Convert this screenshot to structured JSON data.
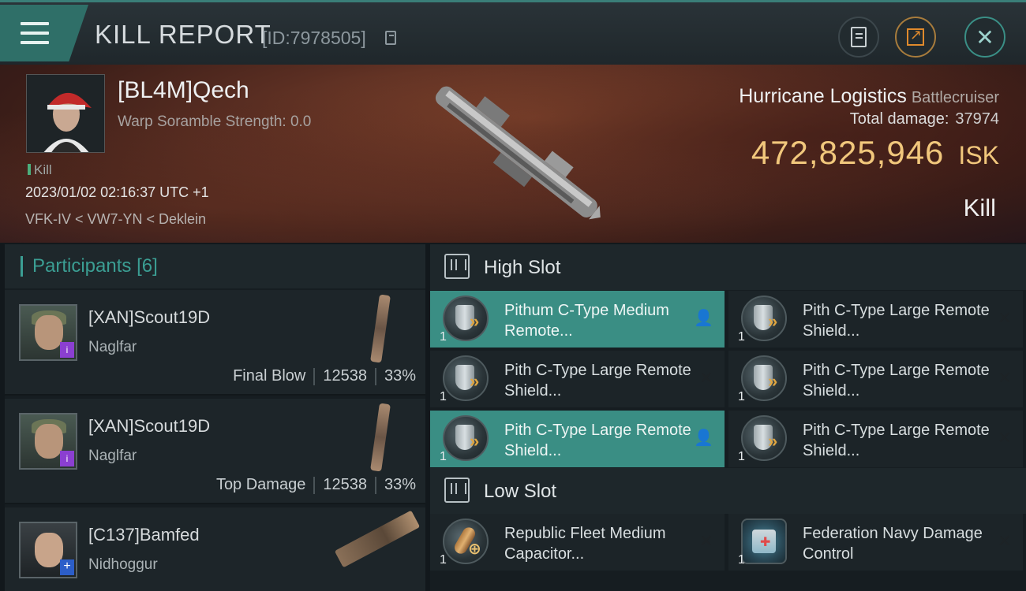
{
  "header": {
    "title": "KILL REPORT",
    "report_id": "[ID:7978505]",
    "menu_icon": "hamburger-icon",
    "actions": [
      {
        "name": "clipboard",
        "icon": "clipboard-icon"
      },
      {
        "name": "share",
        "icon": "share-icon"
      },
      {
        "name": "close",
        "icon": "close-icon",
        "glyph": "✕"
      }
    ]
  },
  "victim": {
    "name": "[BL4M]Qech",
    "subtitle": "Warp Soramble Strength: 0.0",
    "tag": "Kill",
    "time": "2023/01/02 02:16:37 UTC +1",
    "location": "VFK-IV < VW7-YN < Deklein",
    "ship_name": "Hurricane Logistics",
    "ship_class": "Battlecruiser",
    "total_damage_label": "Total damage:",
    "total_damage": "37974",
    "isk_value": "472,825,946",
    "isk_unit": "ISK",
    "result": "Kill"
  },
  "participants": {
    "label": "Participants",
    "count": "[6]",
    "rows": [
      {
        "name": "[XAN]Scout19D",
        "ship": "Naglfar",
        "role": "Final Blow",
        "damage": "12538",
        "pct": "33%",
        "badge": "i"
      },
      {
        "name": "[XAN]Scout19D",
        "ship": "Naglfar",
        "role": "Top Damage",
        "damage": "12538",
        "pct": "33%",
        "badge": "i"
      },
      {
        "name": "[C137]Bamfed",
        "ship": "Nidhoggur",
        "role": "",
        "damage": "",
        "pct": "",
        "badge": "+"
      }
    ]
  },
  "high_slot": {
    "label": "High Slot",
    "modules": [
      {
        "name": "Pithum C-Type Medium Remote...",
        "qty": "1",
        "status": "fitted",
        "icon": "shield-booster-icon"
      },
      {
        "name": "Pith C-Type Large Remote Shield...",
        "qty": "1",
        "status": "destroyed",
        "icon": "shield-booster-icon"
      },
      {
        "name": "Pith C-Type Large Remote Shield...",
        "qty": "1",
        "status": "destroyed",
        "icon": "shield-booster-icon"
      },
      {
        "name": "Pith C-Type Large Remote Shield...",
        "qty": "1",
        "status": "destroyed",
        "icon": "shield-booster-icon"
      },
      {
        "name": "Pith C-Type Large Remote Shield...",
        "qty": "1",
        "status": "fitted",
        "icon": "shield-booster-icon"
      },
      {
        "name": "Pith C-Type Large Remote Shield...",
        "qty": "1",
        "status": "destroyed",
        "icon": "shield-booster-icon"
      }
    ]
  },
  "low_slot": {
    "label": "Low Slot",
    "modules": [
      {
        "name": "Republic Fleet Medium Capacitor...",
        "qty": "1",
        "status": "destroyed",
        "icon": "capacitor-booster-icon"
      },
      {
        "name": "Federation Navy Damage Control",
        "qty": "1",
        "status": "destroyed",
        "icon": "damage-control-icon"
      }
    ]
  },
  "colors": {
    "accent": "#3a8e84",
    "isk": "#f1c77c"
  }
}
